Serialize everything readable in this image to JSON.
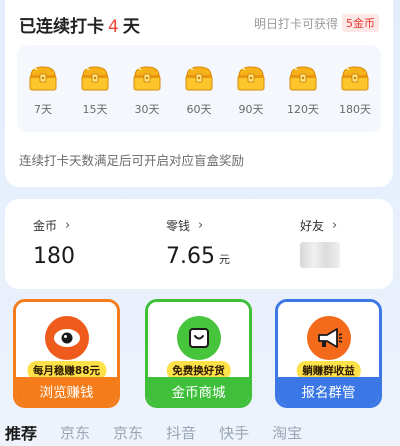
{
  "checkin": {
    "title_prefix": "已连续打卡",
    "days": "4",
    "title_suffix": "天",
    "tomorrow_text": "明日打卡可获得",
    "tomorrow_reward": "5金币",
    "boxes": [
      {
        "label": "7天",
        "icon": "treasure-box-icon"
      },
      {
        "label": "15天",
        "icon": "treasure-box-icon"
      },
      {
        "label": "30天",
        "icon": "treasure-box-icon"
      },
      {
        "label": "60天",
        "icon": "treasure-box-icon"
      },
      {
        "label": "90天",
        "icon": "treasure-box-icon"
      },
      {
        "label": "120天",
        "icon": "treasure-box-icon"
      },
      {
        "label": "180天",
        "icon": "treasure-box-icon"
      }
    ],
    "hint": "连续打卡天数满足后可开启对应盲盒奖励"
  },
  "wallet": {
    "coins_label": "金币",
    "coins_value": "180",
    "change_label": "零钱",
    "change_value": "7.65",
    "change_unit": "元",
    "friends_label": "好友"
  },
  "actions": [
    {
      "pill": "每月稳赚88元",
      "title": "浏览赚钱",
      "icon": "eye-icon"
    },
    {
      "pill": "免费换好货",
      "title": "金币商城",
      "icon": "shopping-bag-icon"
    },
    {
      "pill": "躺赚群收益",
      "title": "报名群管",
      "icon": "megaphone-icon"
    }
  ],
  "tabs": [
    "推荐",
    "京东",
    "京东",
    "抖音",
    "快手",
    "淘宝"
  ],
  "colors": {
    "accent_red": "#f0463a",
    "orange": "#f47c1a",
    "green": "#3fbf3a",
    "blue": "#3b78e6",
    "pill_yellow": "#ffe14a"
  }
}
